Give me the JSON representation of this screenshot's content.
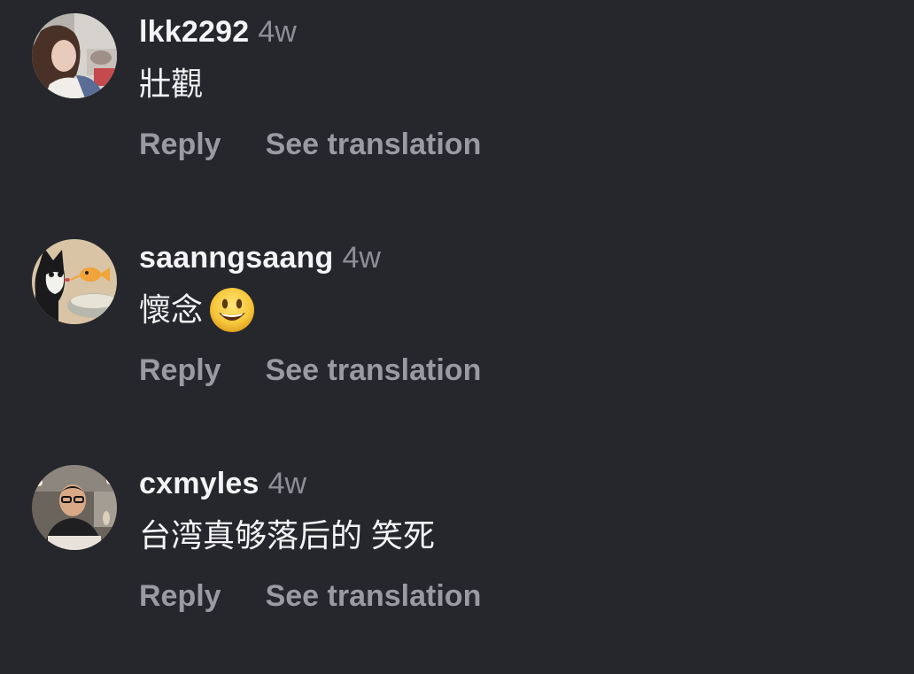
{
  "comments": [
    {
      "username": "lkk2292",
      "time": "4w",
      "text": "壯觀",
      "emoji": "",
      "reply_label": "Reply",
      "translate_label": "See translation"
    },
    {
      "username": "saanngsaang",
      "time": "4w",
      "text": "懷念",
      "emoji": "smiling-face-emoji",
      "reply_label": "Reply",
      "translate_label": "See translation"
    },
    {
      "username": "cxmyles",
      "time": "4w",
      "text": "台湾真够落后的 笑死",
      "emoji": "",
      "reply_label": "Reply",
      "translate_label": "See translation"
    }
  ],
  "colors": {
    "background": "#26272c",
    "primary_text": "#f4f4f6",
    "secondary_text": "#8e8f96",
    "action_text": "#9a9ba2"
  }
}
